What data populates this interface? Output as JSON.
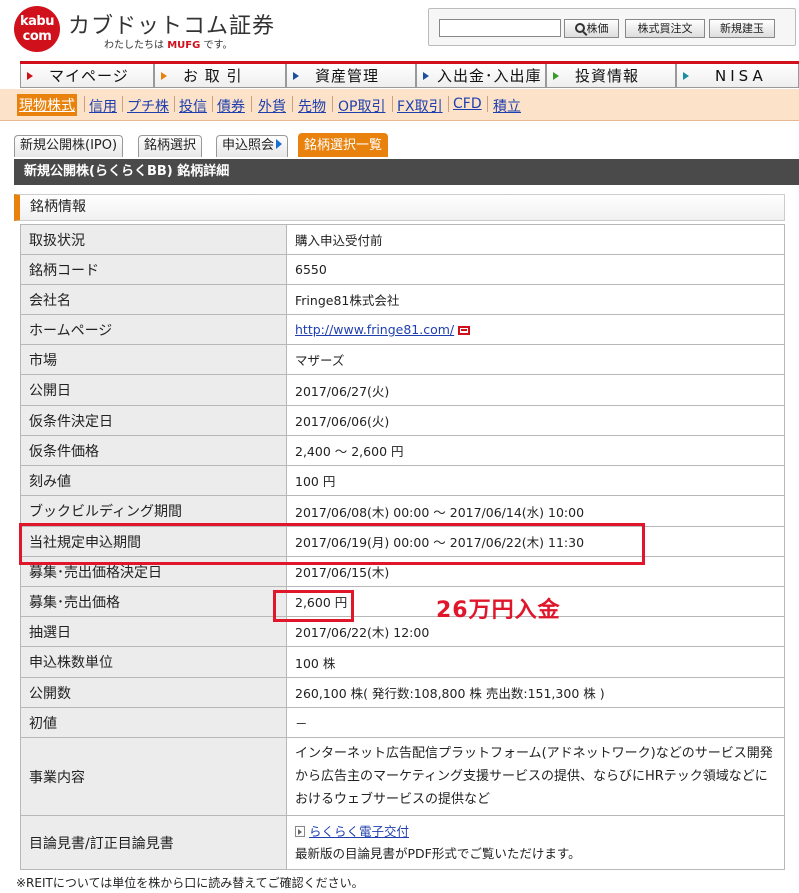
{
  "header": {
    "logo_line1": "kabu",
    "logo_line2": "com",
    "brand_name": "カブドットコム証券",
    "brand_sub_prefix": "わたしたちは",
    "brand_sub_mufg": "MUFG",
    "brand_sub_suffix": "です。",
    "search_value": "",
    "price_button": "株価",
    "margin_button": "株式買注文",
    "newsell_button": "新規建玉"
  },
  "main_nav": [
    {
      "label": "マイページ"
    },
    {
      "label": "お 取 引"
    },
    {
      "label": "資産管理"
    },
    {
      "label": "入出金･入出庫"
    },
    {
      "label": "投資情報"
    },
    {
      "label": "NISA"
    }
  ],
  "sub_nav": [
    {
      "label": "現物株式",
      "active": true
    },
    {
      "label": "信用"
    },
    {
      "label": "プチ株"
    },
    {
      "label": "投信"
    },
    {
      "label": "債券"
    },
    {
      "label": "外貨"
    },
    {
      "label": "先物"
    },
    {
      "label": "OP取引"
    },
    {
      "label": "FX取引"
    },
    {
      "label": "CFD"
    },
    {
      "label": "積立"
    }
  ],
  "tabs": [
    {
      "label": "新規公開株(IPO)"
    },
    {
      "label": "銘柄選択"
    },
    {
      "label": "申込照会"
    },
    {
      "label": "銘柄選択一覧",
      "active": true
    }
  ],
  "title_bar": "新規公開株(らくらくBB)  銘柄詳細",
  "section_head": "銘柄情報",
  "rows": [
    {
      "key": "取扱状況",
      "value": "購入申込受付前"
    },
    {
      "key": "銘柄コード",
      "value": "6550"
    },
    {
      "key": "会社名",
      "value": "Fringe81株式会社"
    },
    {
      "key": "ホームページ",
      "value": "http://www.fringe81.com/"
    },
    {
      "key": "市場",
      "value": "マザーズ"
    },
    {
      "key": "公開日",
      "value": "2017/06/27(火)"
    },
    {
      "key": "仮条件決定日",
      "value": "2017/06/06(火)"
    },
    {
      "key": "仮条件価格",
      "value": "2,400 ～ 2,600 円"
    },
    {
      "key": "刻み値",
      "value": "100 円"
    },
    {
      "key": "ブックビルディング期間",
      "value": "2017/06/08(木) 00:00 ～ 2017/06/14(水) 10:00"
    },
    {
      "key": "当社規定申込期間",
      "value": "2017/06/19(月) 00:00 ～ 2017/06/22(木) 11:30"
    },
    {
      "key": "募集･売出価格決定日",
      "value": "2017/06/15(木)"
    },
    {
      "key": "募集･売出価格",
      "value": "2,600 円"
    },
    {
      "key": "抽選日",
      "value": "2017/06/22(木) 12:00"
    },
    {
      "key": "申込株数単位",
      "value": "100 株"
    },
    {
      "key": "公開数",
      "value": "260,100 株(  発行数:108,800 株   売出数:151,300 株 )"
    },
    {
      "key": "初値",
      "value": "－"
    },
    {
      "key": "事業内容",
      "value": "インターネット広告配信プラットフォーム(アドネットワーク)などのサービス開発から広告主のマーケティング支援サービスの提供、ならびにHRテック領域などにおけるウェブサービスの提供など"
    },
    {
      "key": "目論見書/訂正目論見書",
      "value_link": "らくらく電子交付",
      "value_note": "最新版の目論見書がPDF形式でご覧いただけます。"
    }
  ],
  "annotation": "26万円入金",
  "footnote": "※REITについては単位を株から口に読み替えてご確認ください。",
  "colors": {
    "brand_red": "#d0101b",
    "accent_orange": "#e8820c",
    "annotation_red": "#e0162b"
  }
}
